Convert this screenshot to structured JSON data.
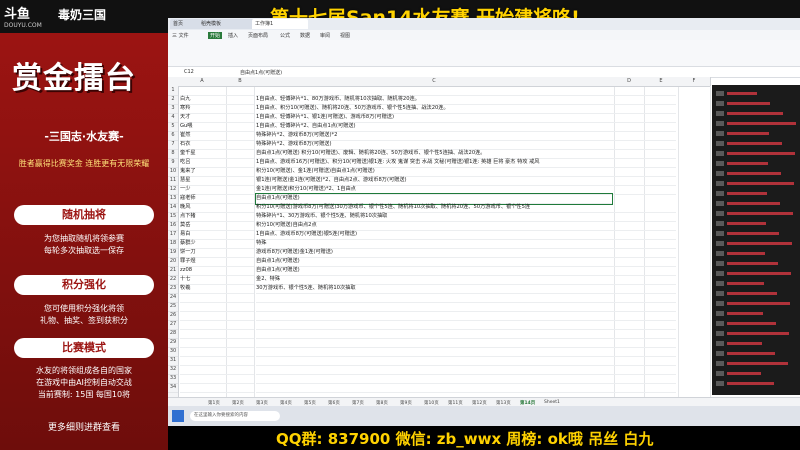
{
  "overlay": {
    "logo": "斗鱼",
    "logo_sub": "DOUYU.COM",
    "channel": "毒奶三国",
    "headline": "第十七届San14水友赛 开始建将咯!",
    "panel_title": "赏金擂台",
    "panel_subtitle": "-三国志·水友赛-",
    "panel_note": "胜者赢得比赛奖金 连胜更有无限荣耀",
    "section1": "随机抽将",
    "section1_lines": [
      "为您抽取随机将领参赛",
      "每轮多次抽取选一保存"
    ],
    "section2": "积分强化",
    "section2_lines": [
      "您可使用积分强化将领",
      "礼物、抽奖、签到获积分"
    ],
    "section3": "比赛模式",
    "section3_lines": [
      "水友的将领组成各自的国家",
      "在游戏中由AI控制自动交战",
      "当前赛制: 15国 每国10将"
    ],
    "footer_note": "更多细则进群查看",
    "bottom_text": "QQ群: 837900  微信: zb_wwx    周榜: ok哦 吊丝 白九"
  },
  "spreadsheet": {
    "cell_ref": "C12",
    "formula": "自由点1点(可赠送)",
    "columns": [
      "A",
      "B",
      "C",
      "D",
      "E",
      "F"
    ],
    "rows": [
      {
        "n": "1",
        "a": "",
        "c": ""
      },
      {
        "n": "2",
        "a": "白九",
        "c": "1自由点、轻傅碎片*1、80万游戏币、随机将10次抽取、随机将20连。"
      },
      {
        "n": "3",
        "a": "寒羚",
        "c": "1自由点、积分10(可赠送)、随机将20连、50万游戏币、银个性5连抽、战法20连。"
      },
      {
        "n": "4",
        "a": "天才",
        "c": "1自由点、轻傅碎片*1、银1连(可赠送)、游戏币8万(可赠送)"
      },
      {
        "n": "5",
        "a": "Gu喂",
        "c": "1自由点、轻傅碎片*2、自由点1点(可赠送)"
      },
      {
        "n": "6",
        "a": "崔然",
        "c": "特殊碎片*2、游戏币8万(可赠送)*2"
      },
      {
        "n": "7",
        "a": "石衣",
        "c": "特殊碎片*2、游戏币8万(可赠送)"
      },
      {
        "n": "8",
        "a": "奎千星",
        "c": "自由点1点(可赠送) 积分10(可赠送)、废辑、随机将20连、50万游戏币、银个性5连抽、战法20连。"
      },
      {
        "n": "9",
        "a": "吃吕",
        "c": "1自由点、游戏币16万(可赠送)、积分10(可赠送)银1连: 火攻 鬼谋 突击 水战 文秘(可赠送)银1连: 英雄 巨将 豪杰 特攻 戒风"
      },
      {
        "n": "10",
        "a": "鬼来了",
        "c": "积分10(可赠送)、金1连(可赠送)自由点1点(可赠送)"
      },
      {
        "n": "11",
        "a": "慧星",
        "c": "银1连(可赠送)金1连(可赠送)*2、自由点2点、游戏币8万(可赠送)"
      },
      {
        "n": "12",
        "a": "一少",
        "c": "金1连(可赠送)积分10(可赠送)*2、1自由点"
      },
      {
        "n": "13",
        "a": "寇老师",
        "c": "自由点1点(可赠送)"
      },
      {
        "n": "14",
        "a": "晚风",
        "c": "积分10(可赠送)游戏币8万(可赠送)30万游戏币、银个性5连、随机将10次抽取、随机将20连、50万游戏币、银个性5连"
      },
      {
        "n": "15",
        "a": "点下猪",
        "c": "特殊碎片*1、30万游戏币、银个性5连、随机将10次抽取"
      },
      {
        "n": "16",
        "a": "莫岳",
        "c": "积分10(可赠送)自由点2点"
      },
      {
        "n": "17",
        "a": "易白",
        "c": "1自由点、游戏币8万(可赠送)银5连(可赠送)"
      },
      {
        "n": "18",
        "a": "蔡群少",
        "c": "特殊"
      },
      {
        "n": "19",
        "a": "饼一刀",
        "c": "游戏币8万(可赠送)金1连(可赠送)"
      },
      {
        "n": "20",
        "a": "罪子煜",
        "c": "自由点1点(可赠送)"
      },
      {
        "n": "21",
        "a": "zz08",
        "c": "自由点1点(可赠送)"
      },
      {
        "n": "22",
        "a": "十七",
        "c": "金2、特殊"
      },
      {
        "n": "23",
        "a": "牧羲",
        "c": "30万游戏币、银个性5连、随机将10次抽取"
      },
      {
        "n": "24",
        "a": "",
        "c": ""
      },
      {
        "n": "25",
        "a": "",
        "c": ""
      },
      {
        "n": "26",
        "a": "",
        "c": ""
      },
      {
        "n": "27",
        "a": "",
        "c": ""
      },
      {
        "n": "28",
        "a": "",
        "c": ""
      },
      {
        "n": "29",
        "a": "",
        "c": ""
      },
      {
        "n": "30",
        "a": "",
        "c": ""
      },
      {
        "n": "31",
        "a": "",
        "c": ""
      },
      {
        "n": "32",
        "a": "",
        "c": ""
      },
      {
        "n": "33",
        "a": "",
        "c": ""
      },
      {
        "n": "34",
        "a": "",
        "c": ""
      }
    ],
    "sheet_tabs": [
      "第1页",
      "第2页",
      "第3页",
      "第4页",
      "第5页",
      "第6页",
      "第7页",
      "第8页",
      "第9页",
      "第10页",
      "第11页",
      "第12页",
      "第13页",
      "第14页",
      "Sheet1"
    ],
    "search_placeholder": "在这里输入你要搜索的内容"
  }
}
